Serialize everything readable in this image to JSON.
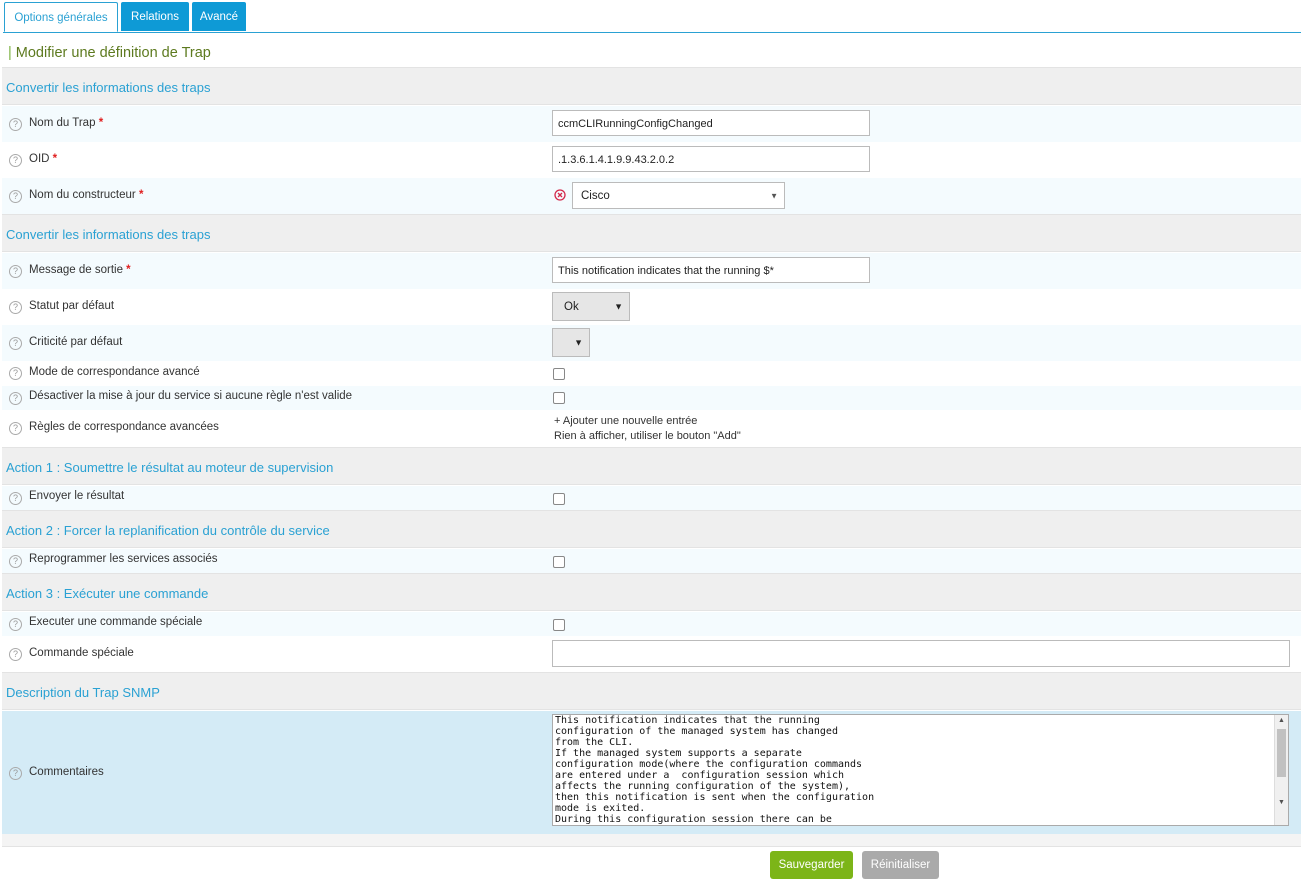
{
  "tabs": [
    {
      "label": "Options générales",
      "active": true
    },
    {
      "label": "Relations",
      "active": false
    },
    {
      "label": "Avancé",
      "active": false
    }
  ],
  "page_title": "Modifier une définition de Trap",
  "sections": {
    "s1": "Convertir les informations des traps",
    "s2": "Convertir les informations des traps",
    "s3": "Action 1 : Soumettre le résultat au moteur de supervision",
    "s4": "Action 2 : Forcer la replanification du contrôle du service",
    "s5": "Action 3 : Exécuter une commande",
    "s6": "Description du Trap SNMP"
  },
  "fields": {
    "trap_name": {
      "label": "Nom du Trap",
      "value": "ccmCLIRunningConfigChanged"
    },
    "oid": {
      "label": "OID",
      "value": ".1.3.6.1.4.1.9.9.43.2.0.2"
    },
    "vendor": {
      "label": "Nom du constructeur",
      "value": "Cisco"
    },
    "output_message": {
      "label": "Message de sortie",
      "value": "This notification indicates that the running $*"
    },
    "default_status": {
      "label": "Statut par défaut",
      "value": "Ok"
    },
    "default_severity": {
      "label": "Criticité par défaut",
      "value": ""
    },
    "advanced_matching": {
      "label": "Mode de correspondance avancé",
      "checked": false
    },
    "disable_update": {
      "label": "Désactiver la mise à jour du service si aucune règle n'est valide",
      "checked": false
    },
    "advanced_rules": {
      "label": "Règles de correspondance avancées",
      "add_link": "+ Ajouter une nouvelle entrée",
      "empty_text": "Rien à afficher, utiliser le bouton \"Add\""
    },
    "send_result": {
      "label": "Envoyer le résultat",
      "checked": false
    },
    "reschedule": {
      "label": "Reprogrammer les services associés",
      "checked": false
    },
    "exec_special": {
      "label": "Executer une commande spéciale",
      "checked": false
    },
    "special_command": {
      "label": "Commande spéciale",
      "value": ""
    },
    "comments": {
      "label": "Commentaires",
      "value": "This notification indicates that the running\nconfiguration of the managed system has changed\nfrom the CLI.\nIf the managed system supports a separate\nconfiguration mode(where the configuration commands\nare entered under a  configuration session which\naffects the running configuration of the system),\nthen this notification is sent when the configuration\nmode is exited.\nDuring this configuration session there can be"
    }
  },
  "required_marker": "*",
  "help_glyph": "?",
  "buttons": {
    "save": "Sauvegarder",
    "reset": "Réinitialiser"
  },
  "colors": {
    "accent": "#2aa1d3",
    "save": "#7cb518",
    "reset": "#aaaaaa",
    "error": "#e02020"
  },
  "icons": {
    "help": "help-icon",
    "vendor_error": "error-circle-icon"
  }
}
